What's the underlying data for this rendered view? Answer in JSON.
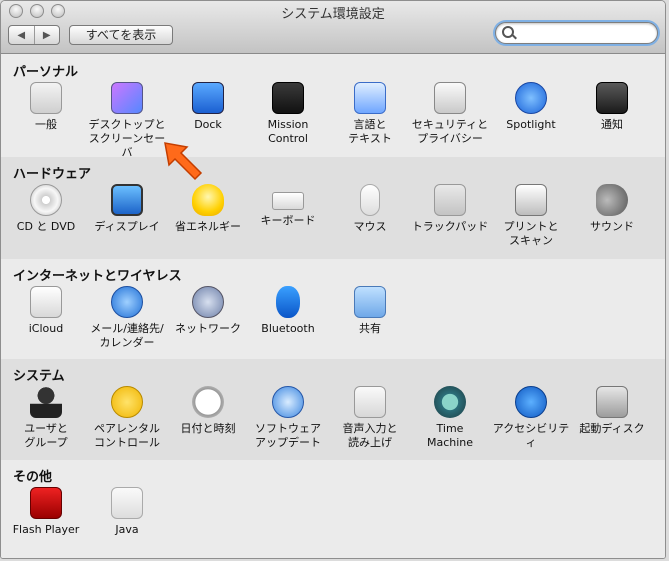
{
  "window": {
    "title": "システム環境設定",
    "nav_back": "◀",
    "nav_forward": "▶",
    "show_all": "すべてを表示",
    "search_placeholder": ""
  },
  "sections": [
    {
      "label": "パーソナル",
      "items": [
        {
          "label": "一般",
          "icon": "general-icon"
        },
        {
          "label": "デスクトップと\nスクリーンセーバ",
          "icon": "desktop-screensaver-icon"
        },
        {
          "label": "Dock",
          "icon": "dock-icon"
        },
        {
          "label": "Mission\nControl",
          "icon": "mission-control-icon"
        },
        {
          "label": "言語と\nテキスト",
          "icon": "language-text-icon"
        },
        {
          "label": "セキュリティと\nプライバシー",
          "icon": "security-icon"
        },
        {
          "label": "Spotlight",
          "icon": "spotlight-icon"
        },
        {
          "label": "通知",
          "icon": "notification-icon"
        }
      ]
    },
    {
      "label": "ハードウェア",
      "items": [
        {
          "label": "CD と DVD",
          "icon": "cd-dvd-icon"
        },
        {
          "label": "ディスプレイ",
          "icon": "display-icon"
        },
        {
          "label": "省エネルギー",
          "icon": "energy-saver-icon"
        },
        {
          "label": "キーボード",
          "icon": "keyboard-icon"
        },
        {
          "label": "マウス",
          "icon": "mouse-icon"
        },
        {
          "label": "トラックパッド",
          "icon": "trackpad-icon"
        },
        {
          "label": "プリントと\nスキャン",
          "icon": "printer-icon"
        },
        {
          "label": "サウンド",
          "icon": "sound-icon"
        }
      ]
    },
    {
      "label": "インターネットとワイヤレス",
      "items": [
        {
          "label": "iCloud",
          "icon": "icloud-icon"
        },
        {
          "label": "メール/連絡先/\nカレンダー",
          "icon": "mail-contacts-icon"
        },
        {
          "label": "ネットワーク",
          "icon": "network-icon"
        },
        {
          "label": "Bluetooth",
          "icon": "bluetooth-icon"
        },
        {
          "label": "共有",
          "icon": "sharing-icon"
        }
      ]
    },
    {
      "label": "システム",
      "items": [
        {
          "label": "ユーザと\nグループ",
          "icon": "users-groups-icon"
        },
        {
          "label": "ペアレンタル\nコントロール",
          "icon": "parental-controls-icon"
        },
        {
          "label": "日付と時刻",
          "icon": "date-time-icon"
        },
        {
          "label": "ソフトウェア\nアップデート",
          "icon": "software-update-icon"
        },
        {
          "label": "音声入力と\n読み上げ",
          "icon": "dictation-speech-icon"
        },
        {
          "label": "Time\nMachine",
          "icon": "time-machine-icon"
        },
        {
          "label": "アクセシビリティ",
          "icon": "accessibility-icon"
        },
        {
          "label": "起動ディスク",
          "icon": "startup-disk-icon"
        }
      ]
    },
    {
      "label": "その他",
      "items": [
        {
          "label": "Flash Player",
          "icon": "flash-player-icon"
        },
        {
          "label": "Java",
          "icon": "java-icon"
        }
      ]
    }
  ]
}
